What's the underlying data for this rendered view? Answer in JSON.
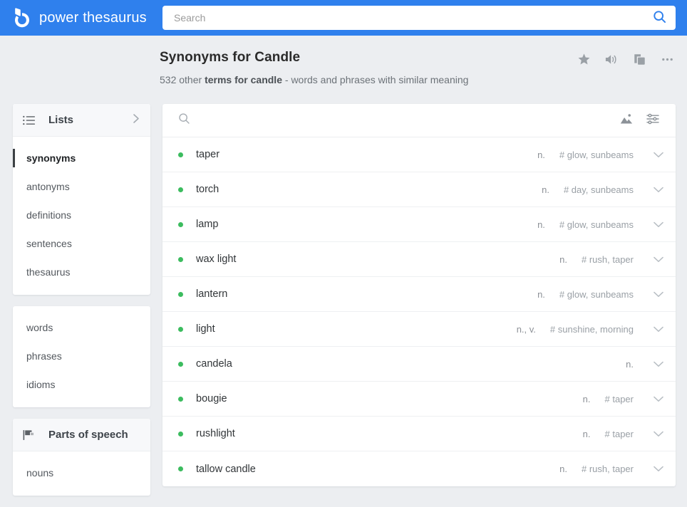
{
  "header": {
    "brand_name": "power thesaurus",
    "logo_icon": "droplet-b-logo-icon",
    "search": {
      "value": "",
      "placeholder": "Search",
      "submit_icon": "search-icon"
    }
  },
  "page": {
    "title": "Synonyms for Candle",
    "subtitle_count": "532 other",
    "subtitle_strong": "terms for candle",
    "subtitle_tail": "- words and phrases with similar meaning",
    "actions": [
      {
        "name": "favorite-star-button",
        "icon": "star-icon"
      },
      {
        "name": "pronounce-button",
        "icon": "speaker-icon"
      },
      {
        "name": "copy-button",
        "icon": "copy-icon"
      },
      {
        "name": "more-options-button",
        "icon": "ellipsis-icon"
      }
    ]
  },
  "sidebar": {
    "lists_card": {
      "header_label": "Lists",
      "header_icon": "list-icon",
      "expand_icon": "chevron-right-icon",
      "items": [
        {
          "label": "synonyms",
          "active": true
        },
        {
          "label": "antonyms",
          "active": false
        },
        {
          "label": "definitions",
          "active": false
        },
        {
          "label": "sentences",
          "active": false
        },
        {
          "label": "thesaurus",
          "active": false
        }
      ]
    },
    "types_card": {
      "items": [
        {
          "label": "words"
        },
        {
          "label": "phrases"
        },
        {
          "label": "idioms"
        }
      ]
    },
    "pos_card": {
      "header_label": "Parts of speech",
      "header_icon": "flag-icon",
      "items": [
        {
          "label": "nouns"
        }
      ]
    }
  },
  "results": {
    "filterbar": {
      "search_icon": "search-icon",
      "image_icon": "image-icon",
      "filter_icon": "sliders-filter-icon"
    },
    "rows": [
      {
        "term": "taper",
        "pos": "n.",
        "tags": "# glow, sunbeams"
      },
      {
        "term": "torch",
        "pos": "n.",
        "tags": "# day, sunbeams"
      },
      {
        "term": "lamp",
        "pos": "n.",
        "tags": "# glow, sunbeams"
      },
      {
        "term": "wax light",
        "pos": "n.",
        "tags": "# rush, taper"
      },
      {
        "term": "lantern",
        "pos": "n.",
        "tags": "# glow, sunbeams"
      },
      {
        "term": "light",
        "pos": "n., v.",
        "tags": "# sunshine, morning"
      },
      {
        "term": "candela",
        "pos": "n.",
        "tags": ""
      },
      {
        "term": "bougie",
        "pos": "n.",
        "tags": "# taper"
      },
      {
        "term": "rushlight",
        "pos": "n.",
        "tags": "# taper"
      },
      {
        "term": "tallow candle",
        "pos": "n.",
        "tags": "# rush, taper"
      }
    ]
  },
  "colors": {
    "header_blue": "#2f80ed",
    "page_background": "#eceef1",
    "dot_green": "#3cbc5f",
    "card_white": "#ffffff"
  }
}
